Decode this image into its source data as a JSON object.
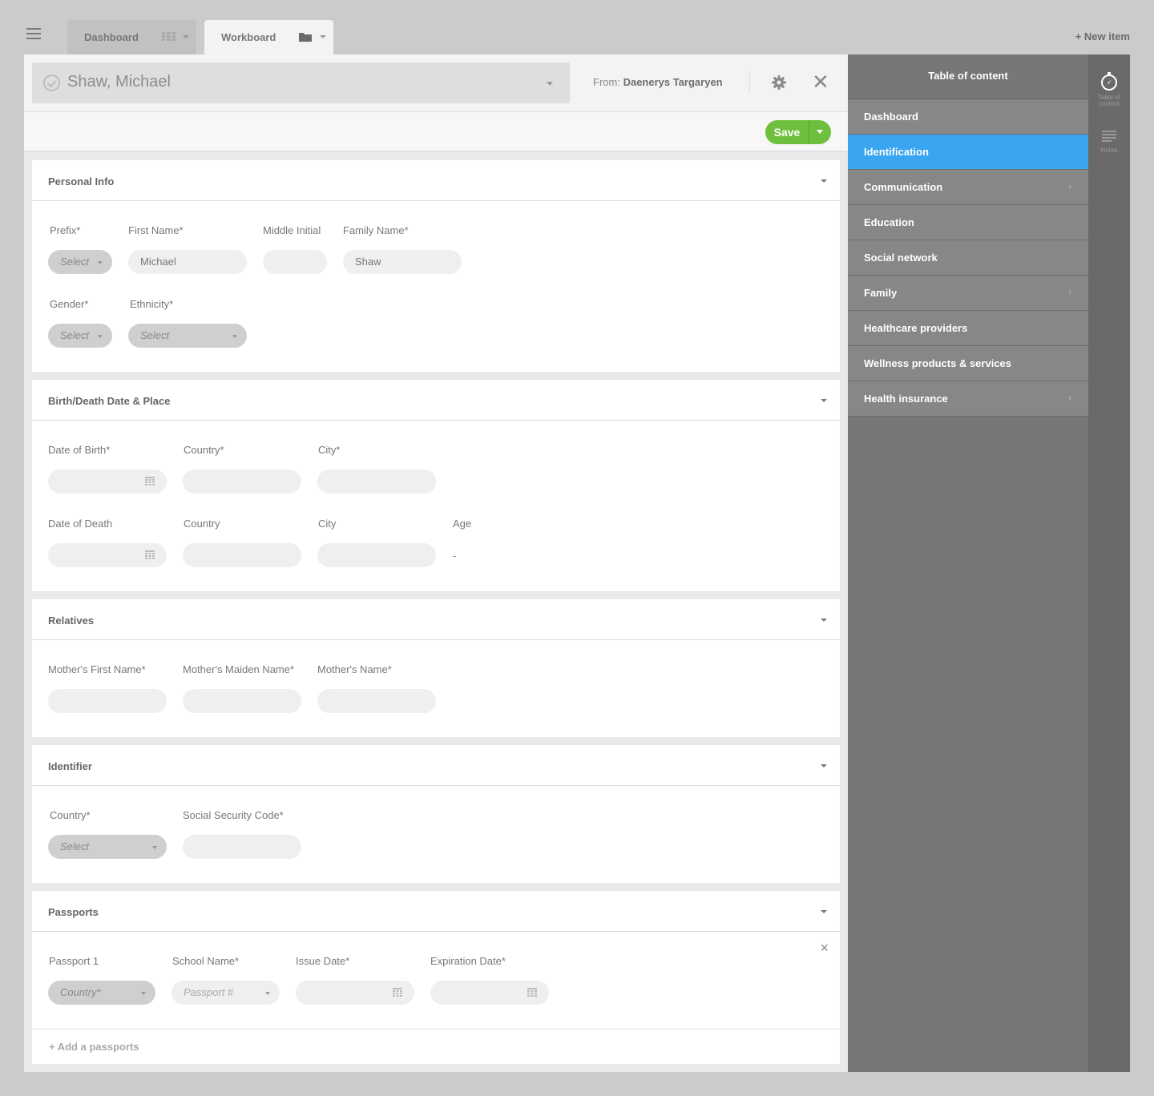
{
  "tabs": [
    {
      "label": "Dashboard",
      "icon": "grid-icon"
    },
    {
      "label": "Workboard",
      "icon": "folder-icon"
    }
  ],
  "new_item_label": "+ New item",
  "record": {
    "name": "Shaw, Michael",
    "from_label": "From:",
    "from_name": "Daenerys Targaryen"
  },
  "toolbar": {
    "save_label": "Save"
  },
  "personal_info": {
    "title": "Personal Info",
    "prefix_label": "Prefix*",
    "prefix_value": "Select",
    "first_name_label": "First Name*",
    "first_name_value": "Michael",
    "middle_initial_label": "Middle Initial",
    "middle_initial_value": "",
    "family_name_label": "Family Name*",
    "family_name_value": "Shaw",
    "gender_label": "Gender*",
    "gender_value": "Select",
    "ethnicity_label": "Ethnicity*",
    "ethnicity_value": "Select"
  },
  "birth_death": {
    "title": "Birth/Death Date & Place",
    "dob_label": "Date of Birth*",
    "birth_country_label": "Country*",
    "birth_city_label": "City*",
    "dod_label": "Date of Death",
    "death_country_label": "Country",
    "death_city_label": "City",
    "age_label": "Age",
    "age_value": "-"
  },
  "relatives": {
    "title": "Relatives",
    "mother_first_label": "Mother's First Name*",
    "mother_maiden_label": "Mother's Maiden Name*",
    "mother_name_label": "Mother's Name*"
  },
  "identifier": {
    "title": "Identifier",
    "country_label": "Country*",
    "country_value": "Select",
    "ssn_label": "Social Security Code*"
  },
  "passports": {
    "title": "Passports",
    "passport_label": "Passport 1",
    "country_placeholder": "Country*",
    "school_label": "School Name*",
    "passport_placeholder": "Passport #",
    "issue_label": "Issue Date*",
    "expiration_label": "Expiration Date*",
    "add_label": "+ Add a passports"
  },
  "toc": {
    "title": "Table of content",
    "items": [
      {
        "label": "Dashboard",
        "active": false,
        "arrow": false
      },
      {
        "label": "Identification",
        "active": true,
        "arrow": false
      },
      {
        "label": "Communication",
        "active": false,
        "arrow": true
      },
      {
        "label": "Education",
        "active": false,
        "arrow": false
      },
      {
        "label": "Social network",
        "active": false,
        "arrow": false
      },
      {
        "label": "Family",
        "active": false,
        "arrow": true
      },
      {
        "label": "Healthcare providers",
        "active": false,
        "arrow": false
      },
      {
        "label": "Wellness products & services",
        "active": false,
        "arrow": false
      },
      {
        "label": "Health insurance",
        "active": false,
        "arrow": true
      }
    ]
  },
  "rail": {
    "toc_label": "Table of content",
    "notes_label": "Notes"
  },
  "colors": {
    "accent": "#3aa5f0",
    "save": "#6fbf3e"
  }
}
